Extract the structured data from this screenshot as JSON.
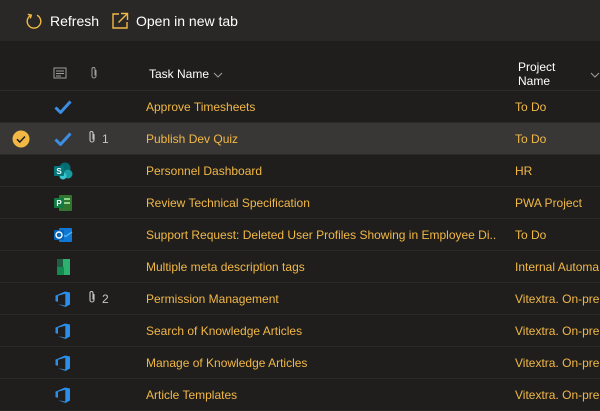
{
  "toolbar": {
    "refresh_label": "Refresh",
    "open_new_tab_label": "Open in new tab"
  },
  "columns": {
    "task_name": "Task Name",
    "project_name": "Project Name"
  },
  "colors": {
    "accent": "#f2b846",
    "background": "#1f1e1d",
    "toolbar": "#292827",
    "selected_row": "#383736"
  },
  "rows": [
    {
      "icon": "todo-check-icon",
      "attachments": "",
      "task": "Approve Timesheets",
      "project": "To Do",
      "selected": false
    },
    {
      "icon": "todo-check-icon",
      "attachments": "1",
      "task": "Publish Dev Quiz",
      "project": "To Do",
      "selected": true
    },
    {
      "icon": "sharepoint-icon",
      "attachments": "",
      "task": "Personnel Dashboard",
      "project": "HR",
      "selected": false
    },
    {
      "icon": "project-icon",
      "attachments": "",
      "task": "Review Technical Specification",
      "project": "PWA Project",
      "selected": false
    },
    {
      "icon": "outlook-icon",
      "attachments": "",
      "task": "Support Request: Deleted User Profiles Showing in Employee Di...",
      "project": "To Do",
      "selected": false
    },
    {
      "icon": "planner-icon",
      "attachments": "",
      "task": "Multiple meta description tags",
      "project": "Internal Automa",
      "selected": false
    },
    {
      "icon": "azure-devops-icon",
      "attachments": "2",
      "task": "Permission Management",
      "project": "Vitextra. On-pre",
      "selected": false
    },
    {
      "icon": "azure-devops-icon",
      "attachments": "",
      "task": "Search of Knowledge Articles",
      "project": "Vitextra. On-pre",
      "selected": false
    },
    {
      "icon": "azure-devops-icon",
      "attachments": "",
      "task": "Manage of Knowledge Articles",
      "project": "Vitextra. On-pre",
      "selected": false
    },
    {
      "icon": "azure-devops-icon",
      "attachments": "",
      "task": "Article Templates",
      "project": "Vitextra. On-pre",
      "selected": false
    }
  ]
}
